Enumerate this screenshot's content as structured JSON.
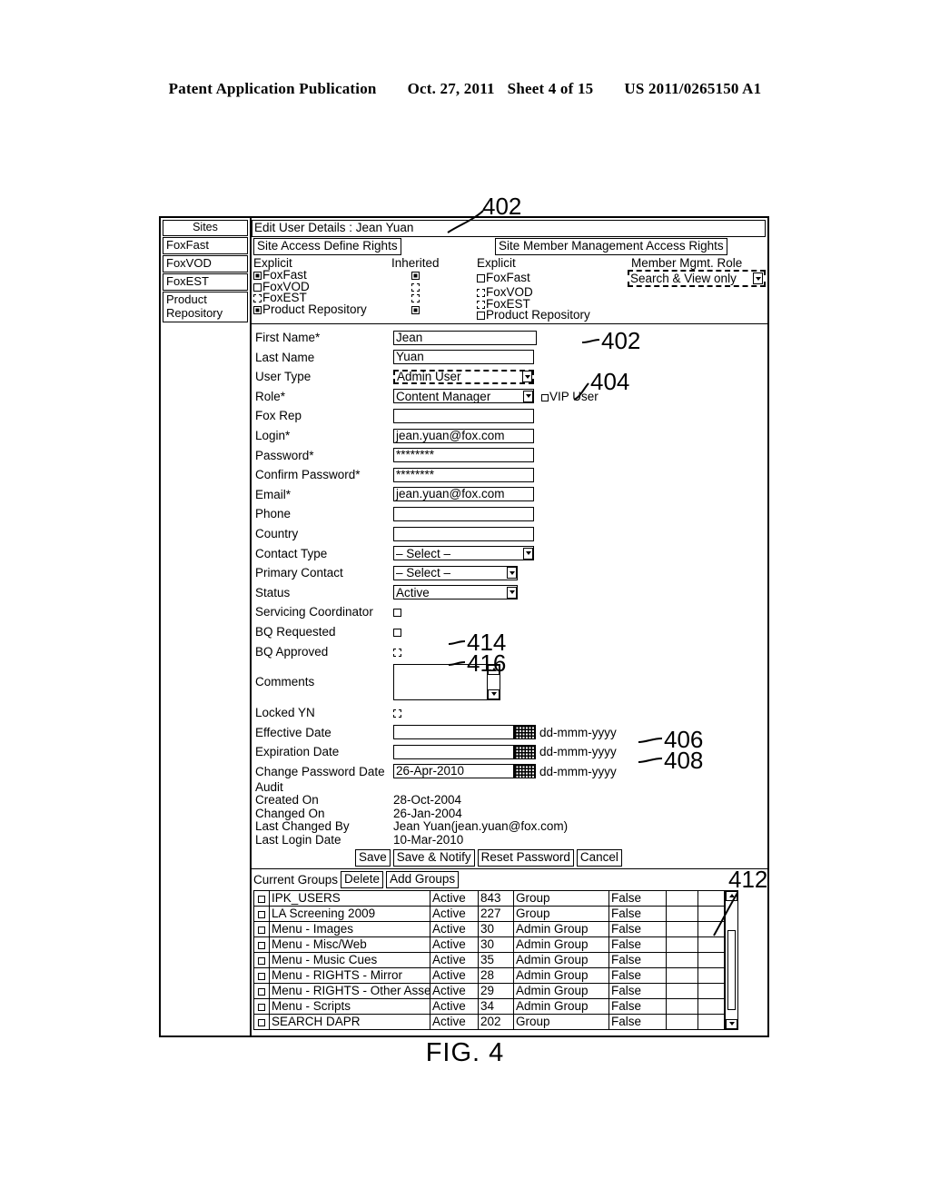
{
  "patent_header": {
    "publication": "Patent Application Publication",
    "date": "Oct. 27, 2011",
    "sheet": "Sheet 4 of 15",
    "number": "US 2011/0265150 A1"
  },
  "figure_caption": "FIG. 4",
  "sidebar": {
    "header": "Sites",
    "items": [
      {
        "label": "FoxFast"
      },
      {
        "label": "FoxVOD"
      },
      {
        "label": "FoxEST"
      },
      {
        "label": "Product Repository"
      }
    ]
  },
  "panel": {
    "title": "Edit User Details : Jean Yuan",
    "site_access": {
      "tab_label": "Site Access Define Rights",
      "col_explicit": "Explicit",
      "col_inherited": "Inherited",
      "rows": [
        {
          "label": "FoxFast",
          "explicit": "checked",
          "inherited": "dashed-checked"
        },
        {
          "label": "FoxVOD",
          "explicit": "empty",
          "inherited": "dashed"
        },
        {
          "label": "FoxEST",
          "explicit": "dashed",
          "inherited": "dashed"
        },
        {
          "label": "Product Repository",
          "explicit": "checked",
          "inherited": "dashed-checked"
        }
      ]
    },
    "member_mgmt": {
      "tab_label": "Site Member Management Access Rights",
      "col_explicit": "Explicit",
      "role_label": "Member Mgmt. Role",
      "role_value": "Search & View only",
      "rows": [
        {
          "label": "FoxFast",
          "explicit": "empty"
        },
        {
          "label": "FoxVOD",
          "explicit": "dashed"
        },
        {
          "label": "FoxEST",
          "explicit": "dashed"
        },
        {
          "label": "Product Repository",
          "explicit": "empty"
        }
      ]
    }
  },
  "form": {
    "fields": [
      {
        "label": "First Name*",
        "type": "text",
        "value": "Jean"
      },
      {
        "label": "Last Name",
        "type": "text",
        "value": "Yuan"
      },
      {
        "label": "User Type",
        "type": "select-dashed",
        "value": "Admin User"
      },
      {
        "label": "Role*",
        "type": "select",
        "value": "Content Manager",
        "extra": "VIP User"
      },
      {
        "label": "Fox Rep",
        "type": "text",
        "value": ""
      },
      {
        "label": "Login*",
        "type": "text",
        "value": "jean.yuan@fox.com"
      },
      {
        "label": "Password*",
        "type": "text",
        "value": "********"
      },
      {
        "label": "Confirm Password*",
        "type": "text",
        "value": "********"
      },
      {
        "label": "Email*",
        "type": "text",
        "value": "jean.yuan@fox.com"
      },
      {
        "label": "Phone",
        "type": "text",
        "value": ""
      },
      {
        "label": "Country",
        "type": "text",
        "value": ""
      },
      {
        "label": "Contact Type",
        "type": "select",
        "value": "– Select –"
      },
      {
        "label": "Primary Contact",
        "type": "select-narrow",
        "value": "– Select –"
      },
      {
        "label": "Status",
        "type": "select-narrow",
        "value": "Active"
      }
    ],
    "checkbox_fields": [
      {
        "label": "Servicing Coordinator",
        "state": "empty",
        "ref": ""
      },
      {
        "label": "BQ Requested",
        "state": "empty",
        "ref": "414"
      },
      {
        "label": "BQ Approved",
        "state": "dashed",
        "ref": "416"
      }
    ],
    "comments_label": "Comments",
    "comments_value": "",
    "locked_label": "Locked YN",
    "locked_state": "dashed",
    "date_fields": [
      {
        "label": "Effective Date",
        "value": "",
        "hint": "dd-mmm-yyyy",
        "ref": "406"
      },
      {
        "label": "Expiration Date",
        "value": "",
        "hint": "dd-mmm-yyyy",
        "ref": "408"
      },
      {
        "label": "Change Password Date",
        "value": "26-Apr-2010",
        "hint": "dd-mmm-yyyy",
        "ref": ""
      }
    ],
    "audit": {
      "title": "Audit",
      "rows": [
        {
          "key": "Created On",
          "value": "28-Oct-2004"
        },
        {
          "key": "Changed On",
          "value": "26-Jan-2004"
        },
        {
          "key": "Last Changed By",
          "value": "Jean Yuan(jean.yuan@fox.com)"
        },
        {
          "key": "Last Login Date",
          "value": "10-Mar-2010"
        }
      ]
    },
    "buttons": [
      {
        "label": "Save"
      },
      {
        "label": "Save & Notify"
      },
      {
        "label": "Reset Password"
      },
      {
        "label": "Cancel"
      }
    ]
  },
  "groups": {
    "title": "Current Groups",
    "delete_label": "Delete",
    "add_label": "Add Groups",
    "rows": [
      {
        "name": "IPK_USERS",
        "status": "Active",
        "count": "843",
        "type": "Group",
        "flag": "False"
      },
      {
        "name": "LA Screening 2009",
        "status": "Active",
        "count": "227",
        "type": "Group",
        "flag": "False"
      },
      {
        "name": "Menu - Images",
        "status": "Active",
        "count": "30",
        "type": "Admin Group",
        "flag": "False"
      },
      {
        "name": "Menu - Misc/Web",
        "status": "Active",
        "count": "30",
        "type": "Admin Group",
        "flag": "False"
      },
      {
        "name": "Menu - Music Cues",
        "status": "Active",
        "count": "35",
        "type": "Admin Group",
        "flag": "False"
      },
      {
        "name": "Menu - RIGHTS - Mirror",
        "status": "Active",
        "count": "28",
        "type": "Admin Group",
        "flag": "False"
      },
      {
        "name": "Menu - RIGHTS - Other Assets",
        "status": "Active",
        "count": "29",
        "type": "Admin Group",
        "flag": "False"
      },
      {
        "name": "Menu - Scripts",
        "status": "Active",
        "count": "34",
        "type": "Admin Group",
        "flag": "False"
      },
      {
        "name": "SEARCH DAPR",
        "status": "Active",
        "count": "202",
        "type": "Group",
        "flag": "False"
      }
    ]
  },
  "callouts": [
    {
      "ref": "402",
      "note": "title"
    },
    {
      "ref": "402",
      "note": "first-name"
    },
    {
      "ref": "404",
      "note": "role-select"
    },
    {
      "ref": "406",
      "note": "effective-date"
    },
    {
      "ref": "408",
      "note": "expiration-date"
    },
    {
      "ref": "412",
      "note": "groups-table"
    },
    {
      "ref": "414",
      "note": "bq-requested"
    },
    {
      "ref": "416",
      "note": "bq-approved"
    }
  ]
}
